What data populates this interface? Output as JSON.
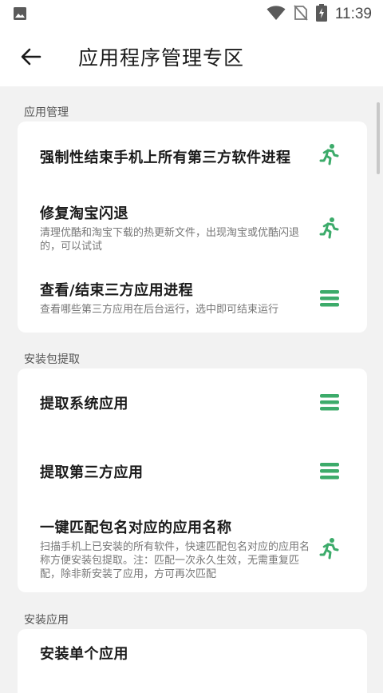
{
  "status_bar": {
    "time": "11:39"
  },
  "header": {
    "title": "应用程序管理专区"
  },
  "sections": [
    {
      "header": "应用管理",
      "items": [
        {
          "title": "强制性结束手机上所有第三方软件进程",
          "desc": "",
          "icon": "run-icon"
        },
        {
          "title": "修复淘宝闪退",
          "desc": "清理优酷和淘宝下载的热更新文件，出现淘宝或优酷闪退的，可以试试",
          "icon": "run-icon"
        },
        {
          "title": "查看/结束三方应用进程",
          "desc": "查看哪些第三方应用在后台运行，选中即可结束运行",
          "icon": "menu-icon"
        }
      ]
    },
    {
      "header": "安装包提取",
      "items": [
        {
          "title": "提取系统应用",
          "desc": "",
          "icon": "menu-icon"
        },
        {
          "title": "提取第三方应用",
          "desc": "",
          "icon": "menu-icon"
        },
        {
          "title": "一键匹配包名对应的应用名称",
          "desc": "扫描手机上已安装的所有软件，快速匹配包名对应的应用名称方便安装包提取。注：匹配一次永久生效，无需重复匹配，除非新安装了应用，方可再次匹配",
          "icon": "run-icon"
        }
      ]
    },
    {
      "header": "安装应用",
      "items": [
        {
          "title": "安装单个应用",
          "desc": "",
          "icon": ""
        }
      ]
    }
  ],
  "colors": {
    "accent": "#3cab6a",
    "background": "#f2f2f2",
    "card": "#ffffff"
  }
}
